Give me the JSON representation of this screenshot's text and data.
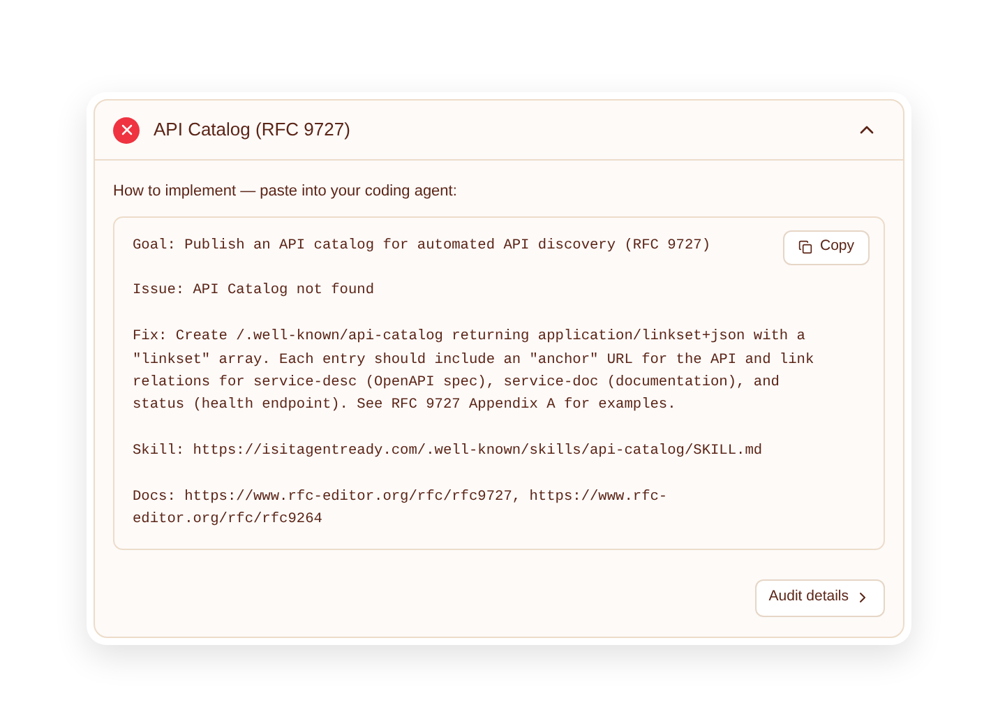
{
  "panel": {
    "title": "API Catalog (RFC 9727)",
    "passed": false,
    "expanded": true
  },
  "instructions_label": "How to implement — paste into your coding agent:",
  "prompt": {
    "paragraphs": [
      "Goal: Publish an API catalog for automated API discovery (RFC 9727)",
      "Issue: API Catalog not found",
      "Fix: Create /.well-known/api-catalog returning application/linkset+json with a \"linkset\" array. Each entry should include an \"anchor\" URL for the API and link relations for service-desc (OpenAPI spec), service-doc (documentation), and status (health endpoint). See RFC 9727 Appendix A for examples.",
      "Skill: https://isitagentready.com/.well-known/skills/api-catalog/SKILL.md",
      "Docs: https://www.rfc-editor.org/rfc/rfc9727, https://www.rfc-editor.org/rfc/rfc9264"
    ],
    "copy_label": "Copy"
  },
  "footer_button": "Audit details"
}
